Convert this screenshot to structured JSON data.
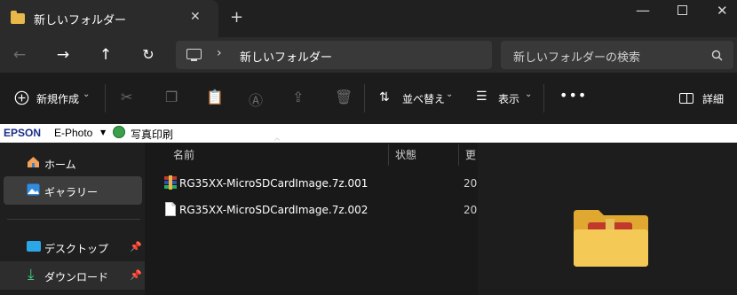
{
  "tab": {
    "title": "新しいフォルダー"
  },
  "address": {
    "path": "新しいフォルダー"
  },
  "search": {
    "placeholder": "新しいフォルダーの検索"
  },
  "commandbar": {
    "new_label": "新規作成",
    "sort_label": "並べ替え",
    "view_label": "表示",
    "details_label": "詳細"
  },
  "epson": {
    "brand": "EPSON",
    "app": "E-Photo",
    "print_label": "写真印刷"
  },
  "sidebar": {
    "items": [
      {
        "label": "ホーム",
        "icon": "home-icon"
      },
      {
        "label": "ギャラリー",
        "icon": "gallery-icon"
      },
      {
        "label": "デスクトップ",
        "icon": "desktop-icon"
      },
      {
        "label": "ダウンロード",
        "icon": "download-icon"
      }
    ]
  },
  "filelist": {
    "columns": {
      "name": "名前",
      "status": "状態",
      "cut": "更"
    },
    "rows": [
      {
        "name": "RG35XX-MicroSDCardImage.7z.001",
        "cut": "20",
        "icon": "archive-icon"
      },
      {
        "name": "RG35XX-MicroSDCardImage.7z.002",
        "cut": "20",
        "icon": "file-icon"
      }
    ]
  },
  "colors": {
    "folder": "#e8b84a",
    "background": "#191919",
    "accent": "#4cc2ff"
  }
}
